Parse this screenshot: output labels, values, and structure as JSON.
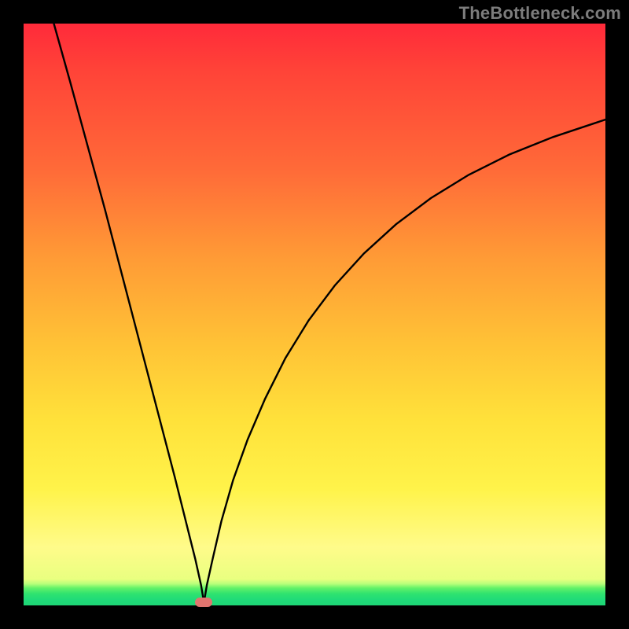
{
  "watermark": "TheBottleneck.com",
  "chart_data": {
    "type": "line",
    "title": "",
    "xlabel": "",
    "ylabel": "",
    "xlim": [
      0,
      1
    ],
    "ylim": [
      0,
      1
    ],
    "grid": false,
    "legend": false,
    "annotations": [],
    "marker": {
      "x": 0.31,
      "y": 0.995
    },
    "series": [
      {
        "name": "left-branch",
        "x": [
          0.052,
          0.08,
          0.11,
          0.14,
          0.17,
          0.2,
          0.23,
          0.26,
          0.28,
          0.295,
          0.305,
          0.31
        ],
        "y": [
          0.0,
          0.1,
          0.21,
          0.32,
          0.435,
          0.55,
          0.665,
          0.78,
          0.86,
          0.92,
          0.965,
          0.995
        ]
      },
      {
        "name": "right-branch",
        "x": [
          0.31,
          0.315,
          0.325,
          0.34,
          0.36,
          0.385,
          0.415,
          0.45,
          0.49,
          0.535,
          0.585,
          0.64,
          0.7,
          0.765,
          0.835,
          0.91,
          1.0
        ],
        "y": [
          0.995,
          0.965,
          0.92,
          0.855,
          0.785,
          0.715,
          0.645,
          0.575,
          0.51,
          0.45,
          0.395,
          0.345,
          0.3,
          0.26,
          0.225,
          0.195,
          0.165
        ]
      }
    ]
  },
  "colors": {
    "background": "#000000",
    "curve": "#000000",
    "marker": "#e0756f",
    "gradient_top": "#ff2a3a",
    "gradient_bottom": "#1ed676"
  }
}
